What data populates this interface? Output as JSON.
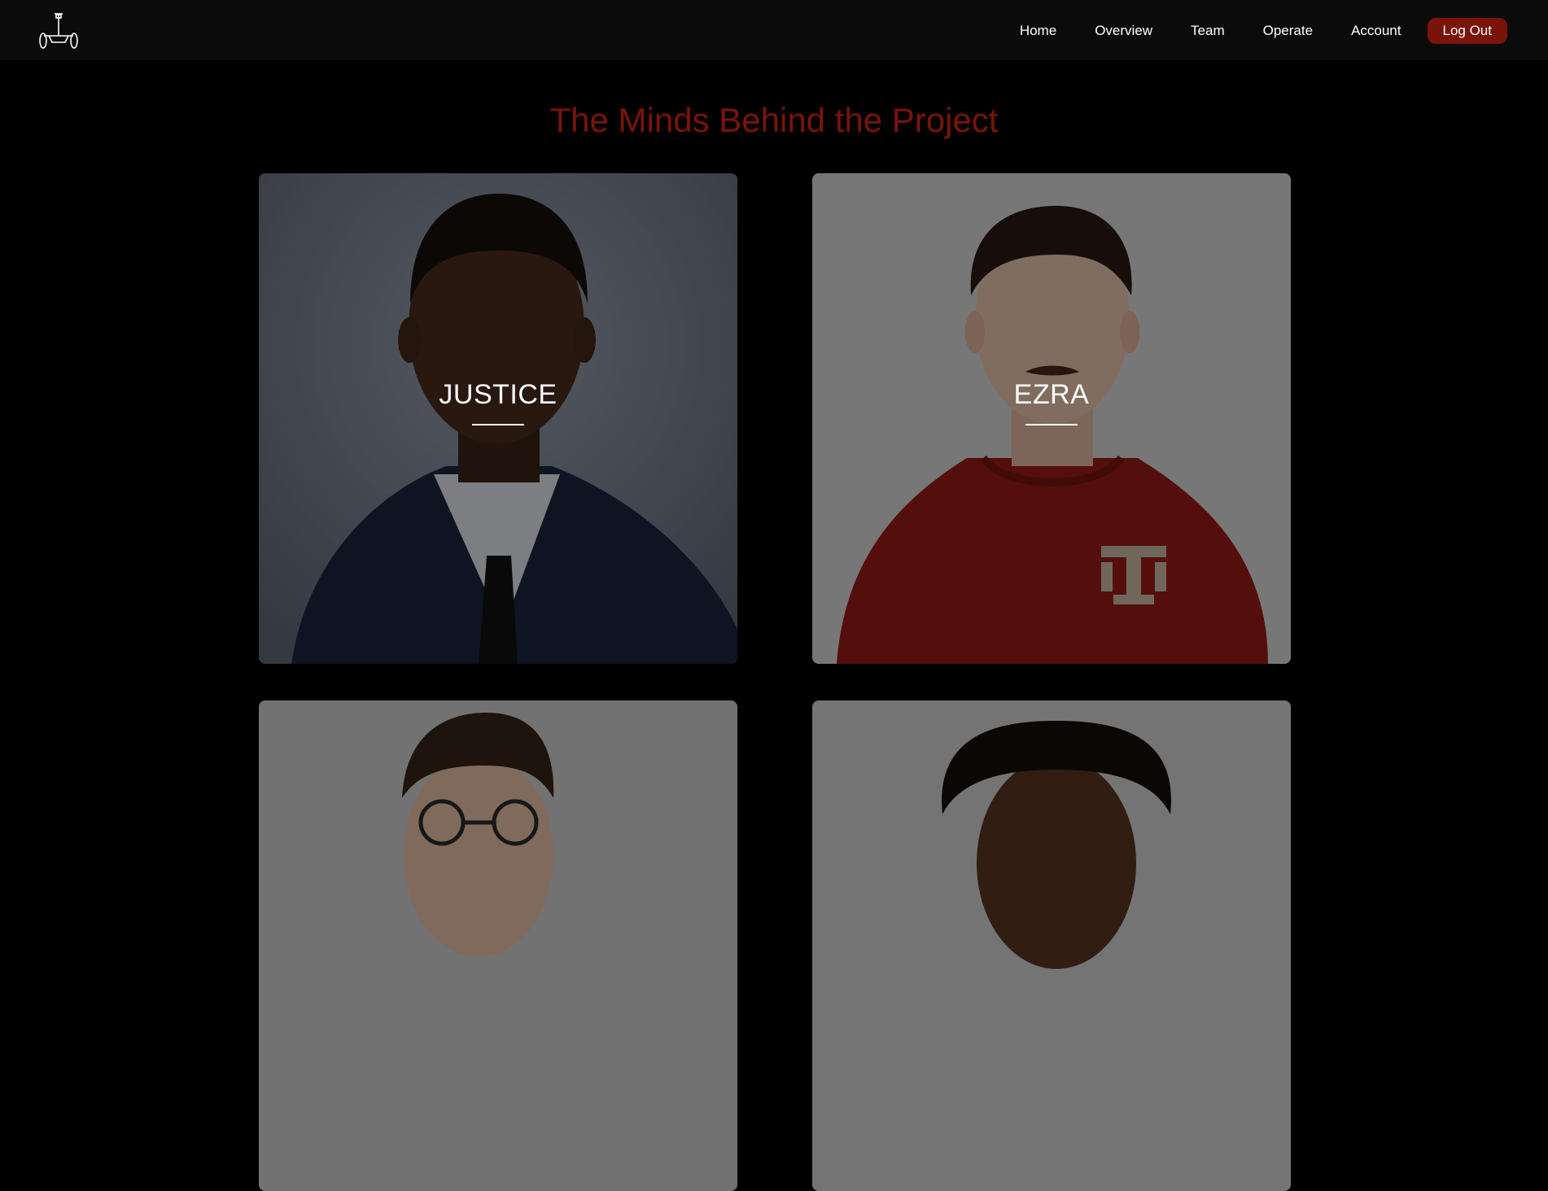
{
  "nav": {
    "logo_icon": "segway-logo-icon",
    "links": [
      "Home",
      "Overview",
      "Team",
      "Operate",
      "Account"
    ],
    "logout_label": "Log Out"
  },
  "page": {
    "title": "The Minds Behind the Project"
  },
  "team": [
    {
      "name": "JUSTICE"
    },
    {
      "name": "EZRA"
    },
    {
      "name": ""
    },
    {
      "name": ""
    }
  ],
  "colors": {
    "accent": "#7a1409",
    "background": "#000000",
    "navbar": "#0b0b0b"
  }
}
